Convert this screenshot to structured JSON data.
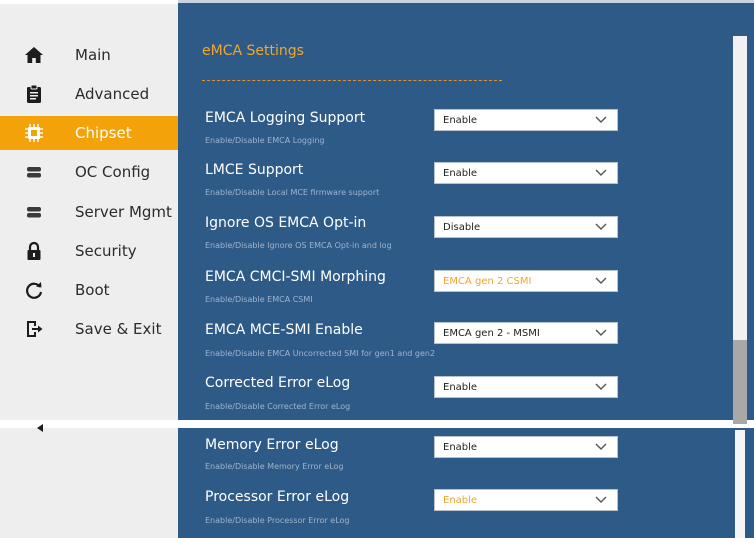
{
  "sidebar": {
    "items": [
      {
        "label": "Main",
        "icon": "home-icon"
      },
      {
        "label": "Advanced",
        "icon": "clipboard-icon"
      },
      {
        "label": "Chipset",
        "icon": "chip-icon"
      },
      {
        "label": "OC Config",
        "icon": "server-icon"
      },
      {
        "label": "Server Mgmt",
        "icon": "server-icon"
      },
      {
        "label": "Security",
        "icon": "lock-icon"
      },
      {
        "label": "Boot",
        "icon": "refresh-icon"
      },
      {
        "label": "Save & Exit",
        "icon": "exit-icon"
      }
    ],
    "active_index": 2,
    "active_color": "#f4a20a"
  },
  "main": {
    "section_title": "eMCA Settings",
    "accent_color": "#f0a62e",
    "background": "#2e5a88",
    "settings": [
      {
        "title": "EMCA Logging Support",
        "help": "Enable/Disable EMCA Logging",
        "value": "Enable",
        "highlight": false
      },
      {
        "title": "LMCE Support",
        "help": "Enable/Disable Local MCE firmware support",
        "value": "Enable",
        "highlight": false
      },
      {
        "title": "Ignore OS EMCA Opt-in",
        "help": "Enable/Disable Ignore OS EMCA Opt-in and log",
        "value": "Disable",
        "highlight": false
      },
      {
        "title": "EMCA CMCI-SMI Morphing",
        "help": "Enable/Disable EMCA CSMI",
        "value": "EMCA gen 2 CSMI",
        "highlight": true
      },
      {
        "title": "EMCA MCE-SMI Enable",
        "help": "Enable/Disable EMCA Uncorrected SMI for gen1 and gen2",
        "value": "EMCA gen 2 - MSMI",
        "highlight": false
      },
      {
        "title": "Corrected Error eLog",
        "help": "Enable/Disable Corrected Error eLog",
        "value": "Enable",
        "highlight": false
      },
      {
        "title": "Memory Error eLog",
        "help": "Enable/Disable Memory Error eLog",
        "value": "Enable",
        "highlight": false
      },
      {
        "title": "Processor Error eLog",
        "help": "Enable/Disable Processor Error eLog",
        "value": "Enable",
        "highlight": true
      }
    ]
  }
}
